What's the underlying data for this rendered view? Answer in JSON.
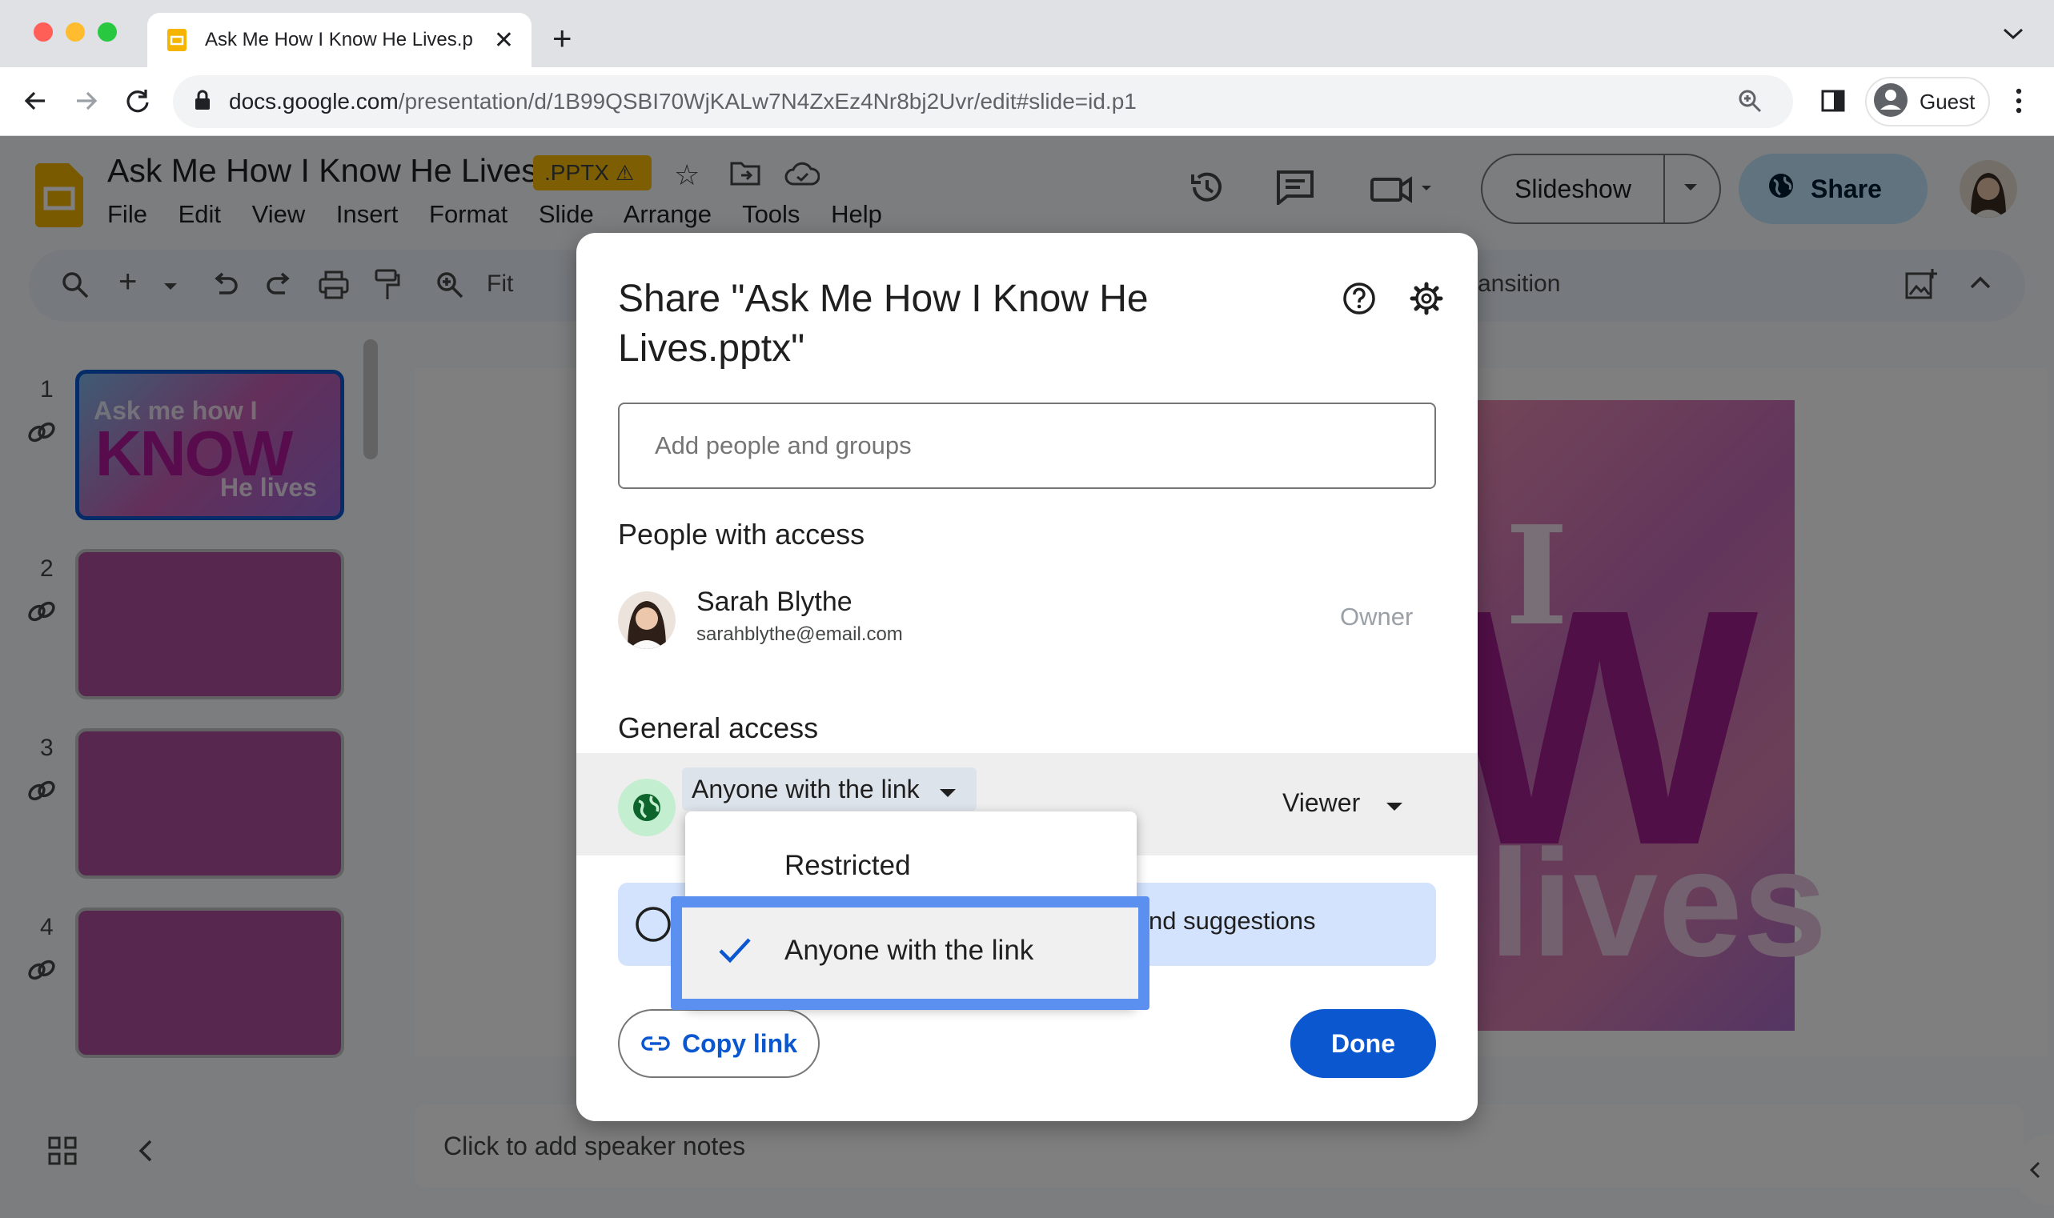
{
  "browser": {
    "tab_title": "Ask Me How I Know He Lives.p",
    "url_host": "docs.google.com",
    "url_path": "/presentation/d/1B99QSBI70WjKALw7N4ZxEz4Nr8bj2Uvr/edit#slide=id.p1",
    "profile_label": "Guest"
  },
  "app": {
    "doc_title": "Ask Me How I Know He Lives",
    "file_badge": ".PPTX",
    "menu": [
      "File",
      "Edit",
      "View",
      "Insert",
      "Format",
      "Slide",
      "Arrange",
      "Tools",
      "Help"
    ],
    "slideshow_label": "Slideshow",
    "share_label": "Share",
    "zoom_label": "Fit",
    "transition_label": "ransition",
    "notes_placeholder": "Click to add speaker notes",
    "slide_numbers": [
      "1",
      "2",
      "3",
      "4"
    ],
    "slide1_text": [
      "Ask me how I",
      "KNOW",
      "He lives"
    ],
    "slide_big_letters": [
      "I",
      "W",
      "lives"
    ]
  },
  "dialog": {
    "title": "Share \"Ask Me How I Know He Lives.pptx\"",
    "add_placeholder": "Add people and groups",
    "people_heading": "People with access",
    "person_name": "Sarah Blythe",
    "person_email": "sarahblythe@email.com",
    "person_role": "Owner",
    "general_heading": "General access",
    "access_value": "Anyone with the link",
    "role_value": "Viewer",
    "info_text": "nd suggestions",
    "copy_link_label": "Copy link",
    "done_label": "Done",
    "dropdown_options": [
      "Restricted",
      "Anyone with the link"
    ]
  }
}
